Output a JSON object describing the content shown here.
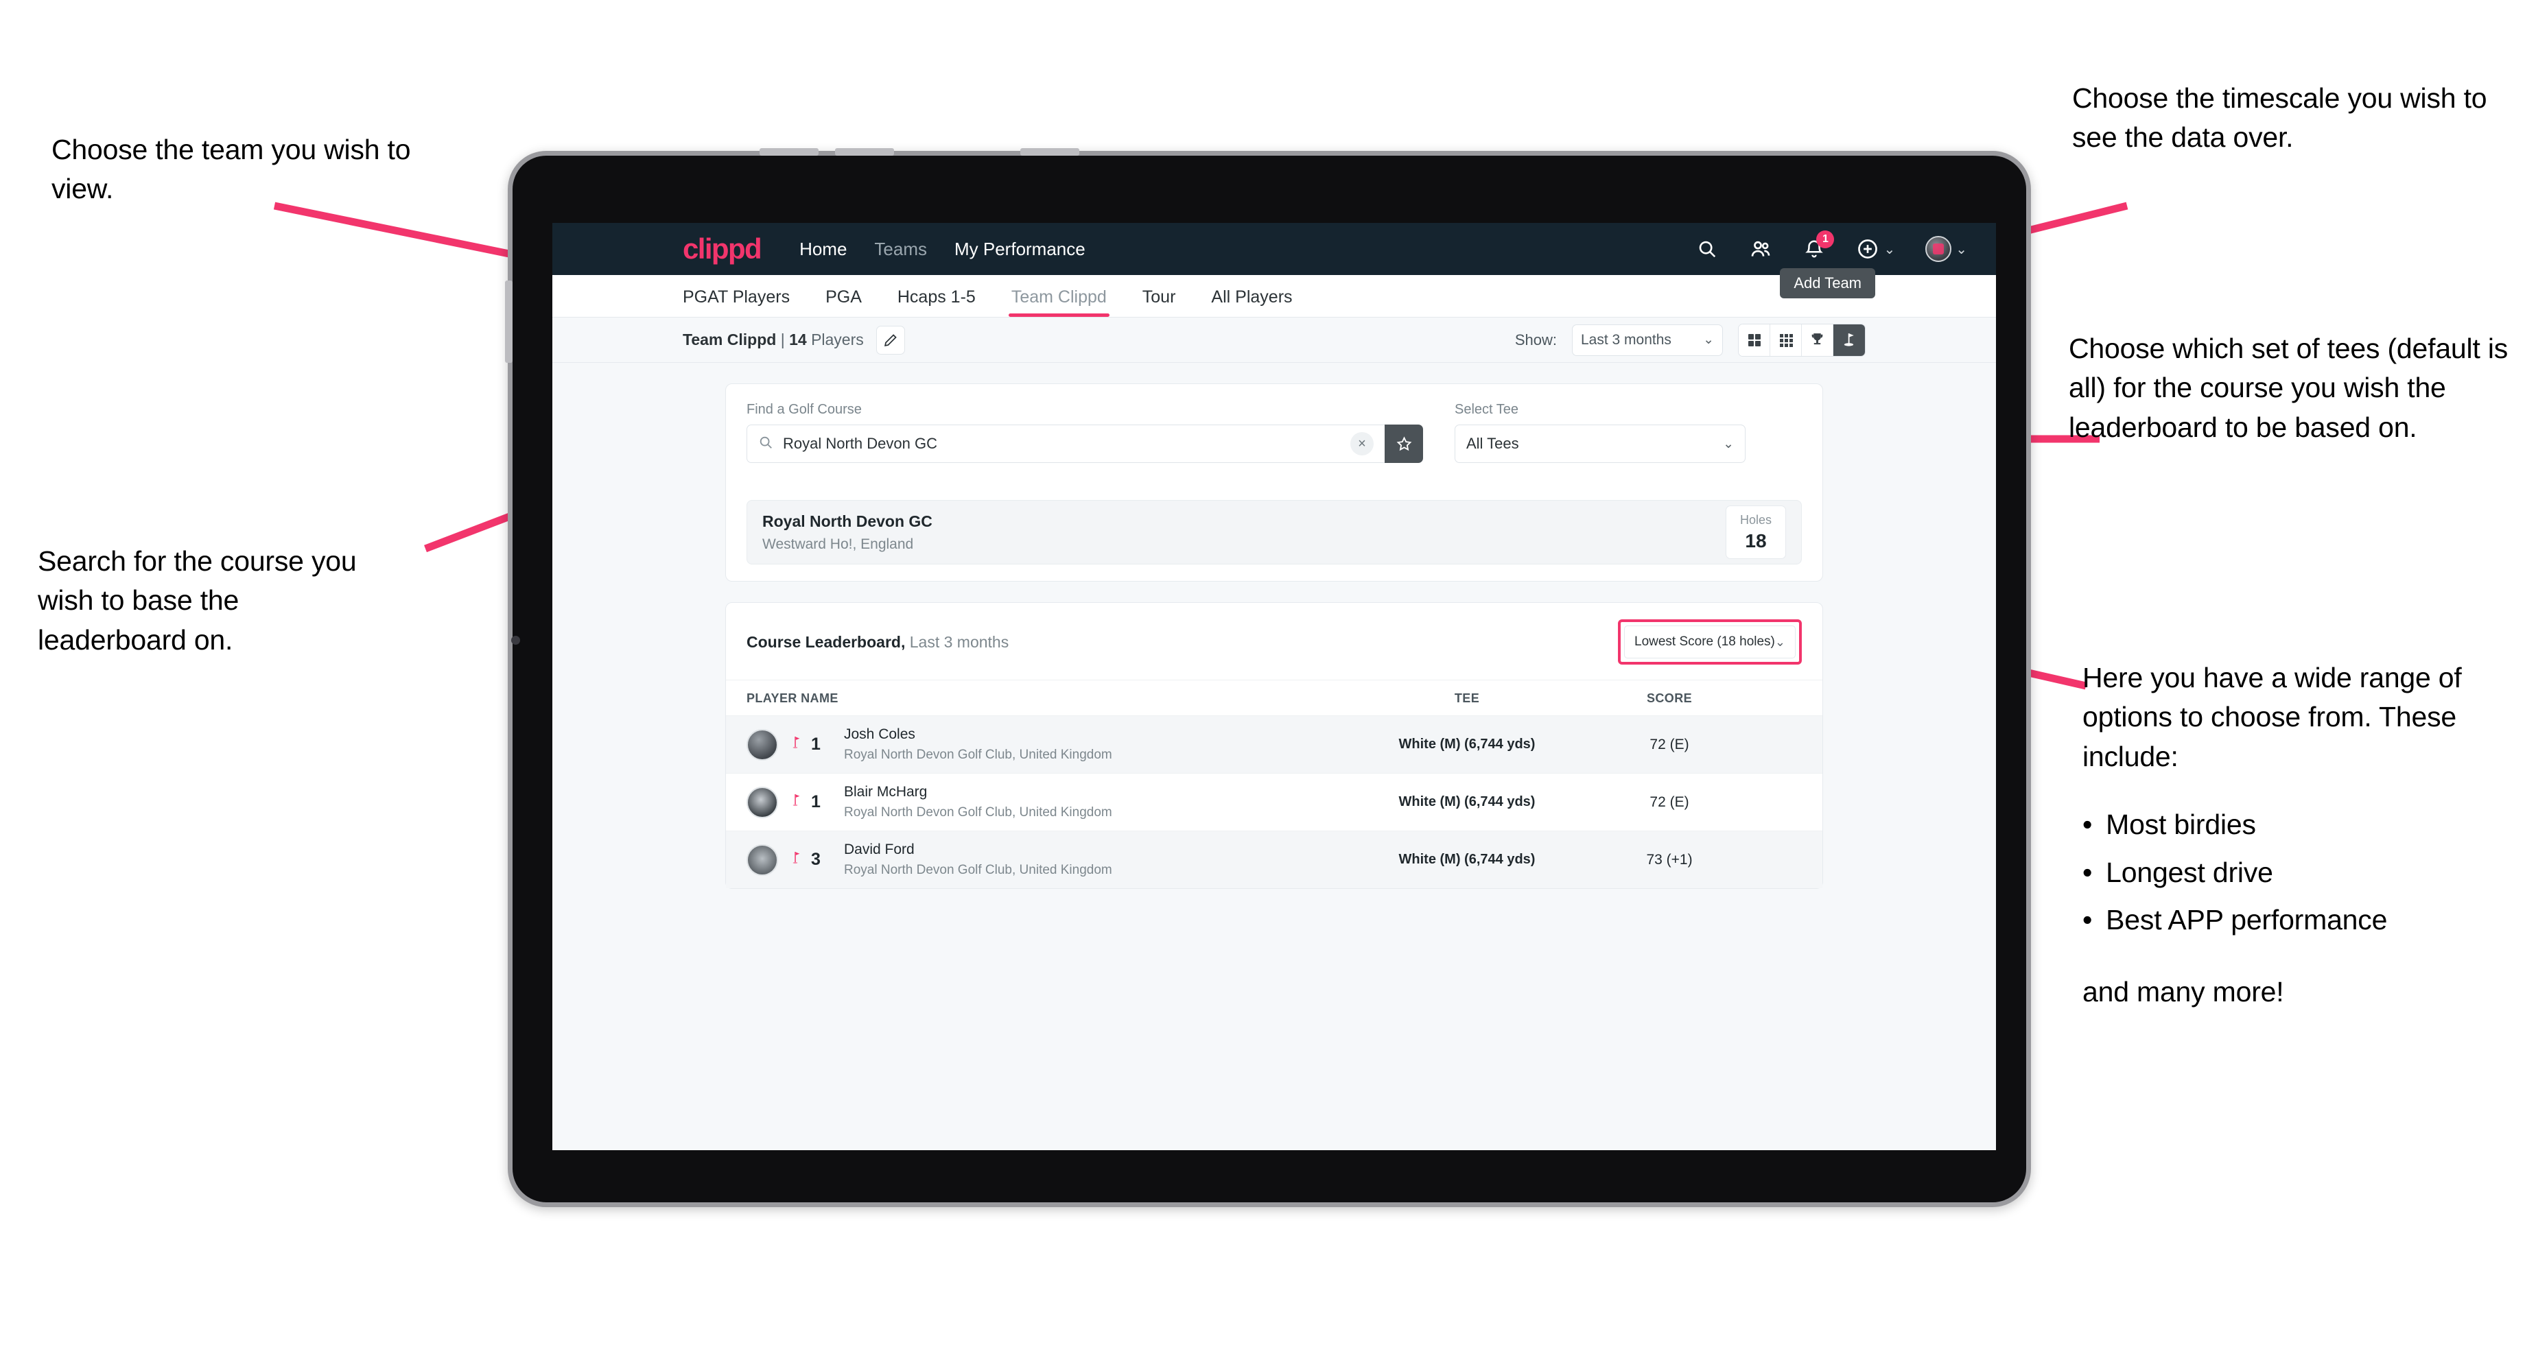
{
  "annotations": {
    "team": "Choose the team you wish to view.",
    "timescale": "Choose the timescale you wish to see the data over.",
    "tees": "Choose which set of tees (default is all) for the course you wish the leaderboard to be based on.",
    "search": "Search for the course you wish to base the leaderboard on.",
    "options_intro": "Here you have a wide range of options to choose from. These include:",
    "options_list": [
      "Most birdies",
      "Longest drive",
      "Best APP performance"
    ],
    "options_tail": "and many more!",
    "bullet_glyph": "•"
  },
  "navbar": {
    "logo": "clippd",
    "links": [
      {
        "label": "Home",
        "active": true
      },
      {
        "label": "Teams",
        "active": false
      },
      {
        "label": "My Performance",
        "active": true
      }
    ],
    "icons": [
      "search-icon",
      "people-icon",
      "bell-icon",
      "plus-icon",
      "avatar-icon"
    ],
    "notification_count": "1"
  },
  "tabs": {
    "items": [
      {
        "label": "PGAT Players",
        "selected": false
      },
      {
        "label": "PGA",
        "selected": false
      },
      {
        "label": "Hcaps 1-5",
        "selected": false
      },
      {
        "label": "Team Clippd",
        "selected": true
      },
      {
        "label": "Tour",
        "selected": false
      },
      {
        "label": "All Players",
        "selected": false
      }
    ],
    "tooltip": "Add Team"
  },
  "subbar": {
    "team_name": "Team Clippd",
    "separator": "|",
    "player_count": "14",
    "players_word": "Players",
    "edit_icon": "pencil-icon",
    "show_label": "Show:",
    "range_value": "Last 3 months",
    "chevron": "⌄",
    "view_buttons": [
      {
        "name": "grid-2x2-view-button",
        "active": false
      },
      {
        "name": "grid-3x3-view-button",
        "active": false
      },
      {
        "name": "trophy-view-button",
        "active": false
      },
      {
        "name": "course-flag-view-button",
        "active": true
      }
    ]
  },
  "search_card": {
    "course_label": "Find a Golf Course",
    "course_value": "Royal North Devon GC",
    "course_placeholder": "Find a Golf Course",
    "clear_glyph": "×",
    "star_icon": "star-icon",
    "tee_label": "Select Tee",
    "tee_value": "All Tees",
    "chevron": "⌄"
  },
  "course_result": {
    "name": "Royal North Devon GC",
    "location": "Westward Ho!, England",
    "holes_label": "Holes",
    "holes_value": "18"
  },
  "leaderboard": {
    "title": "Course Leaderboard,",
    "subtitle": "Last 3 months",
    "sort_value": "Lowest Score (18 holes)",
    "chevron": "⌄",
    "columns": [
      "PLAYER NAME",
      "TEE",
      "SCORE"
    ],
    "rows": [
      {
        "rank": "1",
        "name": "Josh Coles",
        "club": "Royal North Devon Golf Club, United Kingdom",
        "tee": "White (M) (6,744 yds)",
        "score": "72 (E)"
      },
      {
        "rank": "1",
        "name": "Blair McHarg",
        "club": "Royal North Devon Golf Club, United Kingdom",
        "tee": "White (M) (6,744 yds)",
        "score": "72 (E)"
      },
      {
        "rank": "3",
        "name": "David Ford",
        "club": "Royal North Devon Golf Club, United Kingdom",
        "tee": "White (M) (6,744 yds)",
        "score": "73 (+1)"
      }
    ]
  },
  "colors": {
    "accent_pink": "#f2356c",
    "navbar_dark": "#15242f",
    "button_dark": "#4b5257",
    "page_bg": "#f6f8fa"
  }
}
